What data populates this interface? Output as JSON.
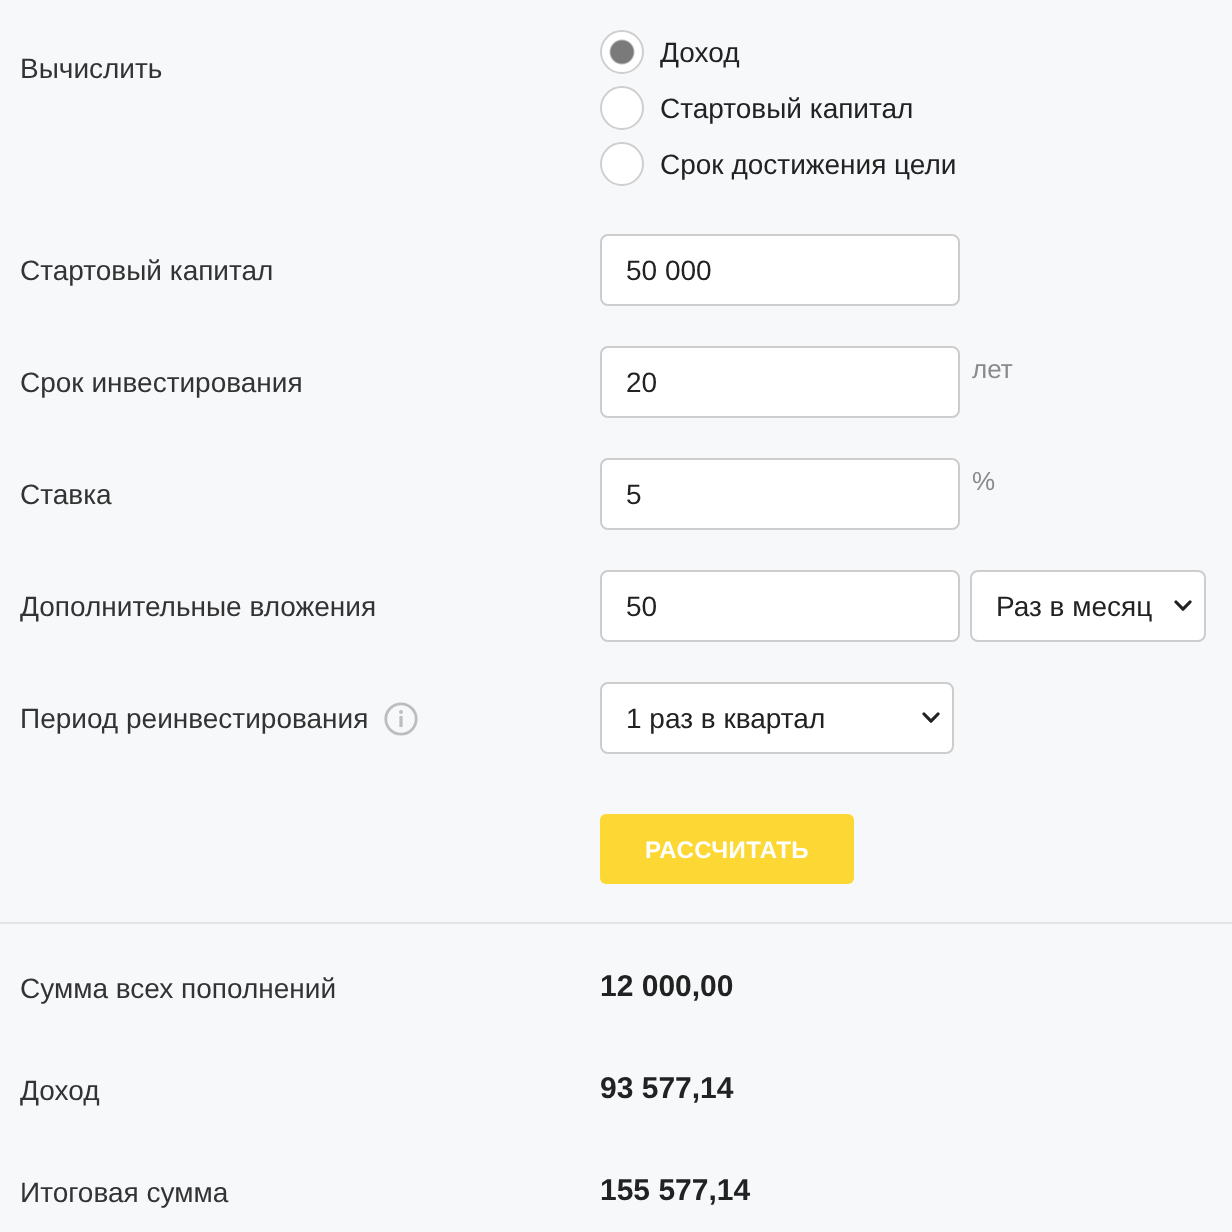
{
  "calculate": {
    "label": "Вычислить",
    "options": [
      {
        "label": "Доход",
        "selected": true
      },
      {
        "label": "Стартовый капитал",
        "selected": false
      },
      {
        "label": "Срок достижения цели",
        "selected": false
      }
    ]
  },
  "fields": [
    {
      "kind": "input",
      "label": "Стартовый капитал",
      "value": "50 000"
    },
    {
      "kind": "input",
      "label": "Срок инвестирования",
      "value": "20",
      "unit": "лет"
    },
    {
      "kind": "input",
      "label": "Ставка",
      "value": "5",
      "unit": "%"
    },
    {
      "kind": "input_select",
      "label": "Дополнительные вложения",
      "value": "50",
      "select": "Раз в месяц"
    },
    {
      "kind": "select",
      "label": "Период реинвестирования",
      "info": true,
      "select": "1 раз в квартал"
    }
  ],
  "button": "РАССЧИТАТЬ",
  "results": [
    {
      "label": "Сумма всех пополнений",
      "value": "12 000,00"
    },
    {
      "label": "Доход",
      "value": "93 577,14"
    },
    {
      "label": "Итоговая сумма",
      "value": "155 577,14"
    }
  ]
}
